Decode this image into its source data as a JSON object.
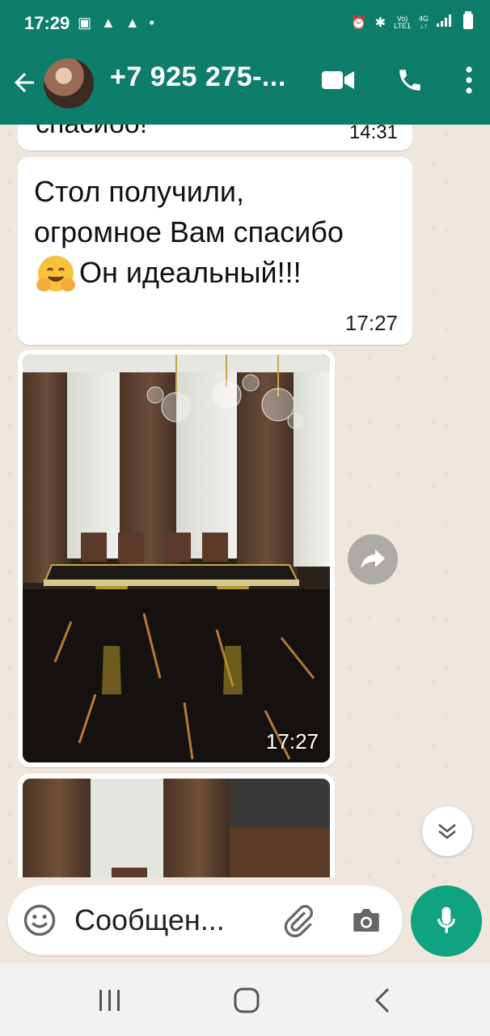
{
  "status_bar": {
    "time": "17:29",
    "icons_left": [
      "gallery-icon",
      "triangle-icon",
      "triangle-icon",
      "dot-icon"
    ],
    "icons_right": [
      "alarm-icon",
      "bluetooth-icon",
      "volte-icon",
      "4g-icon",
      "signal-icon",
      "battery-icon"
    ],
    "network_label_top": "Vo)",
    "network_label_bottom": "LTE1",
    "data_label": "4G"
  },
  "header": {
    "contact_name": "+7 925 275-...",
    "colors": {
      "primary": "#0f7d6c"
    }
  },
  "messages": {
    "previous_tail_text": "спасибо!",
    "previous_time": "14:31",
    "text_lines": [
      "Стол получили,",
      "огромное Вам спасибо",
      "Он идеальный!!!"
    ],
    "text_time": "17:27",
    "photo_time": "17:27"
  },
  "composer": {
    "placeholder": "Сообщен..."
  },
  "colors": {
    "chat_bg": "#efe7dd",
    "mic_green": "#10a37f"
  }
}
